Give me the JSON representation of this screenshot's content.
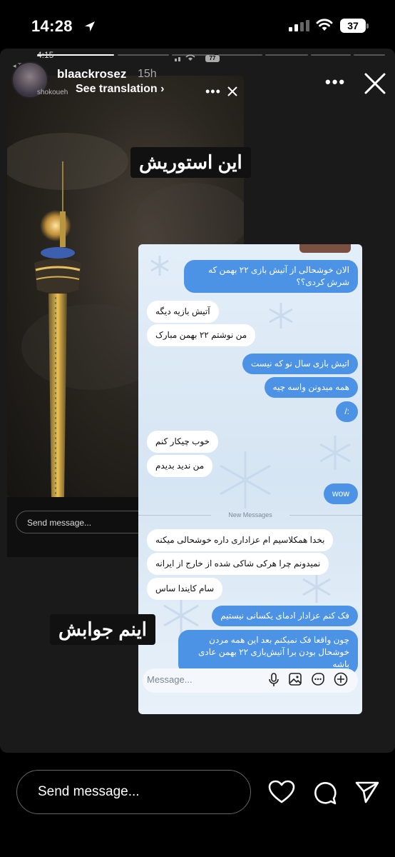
{
  "status_bar": {
    "time": "14:28",
    "battery": "37"
  },
  "inner_status": {
    "time": "4:15",
    "battery": "77",
    "back_label": "◂ Teams"
  },
  "story": {
    "username": "blaackrosez",
    "time_ago": "15h",
    "see_translation": "See translation",
    "avatar_label": "shokoueh",
    "label_top": "این استوریش",
    "label_bottom": "اینم جوابش",
    "inner_send_placeholder": "Send message..."
  },
  "chat": {
    "messages": [
      {
        "dir": "out",
        "text": "الان خوشحالی از آتیش بازی ۲۲ بهمن که شرش کردی؟؟"
      },
      {
        "dir": "in",
        "text": "آتیش بازیه دیگه"
      },
      {
        "dir": "in",
        "text": "من نوشتم ۲۲ بهمن مبارک"
      },
      {
        "dir": "out",
        "text": "اتیش بازی سال نو که نیست"
      },
      {
        "dir": "out",
        "text": "همه میدونن واسه چیه"
      },
      {
        "dir": "out",
        "text": ":/"
      },
      {
        "dir": "in",
        "text": "خوب چیکار کنم"
      },
      {
        "dir": "in",
        "text": "من ندید بدیدم"
      },
      {
        "dir": "out",
        "text": "wow"
      },
      {
        "dir": "in",
        "text": "بخدا همکلاسیم ام عزاداری داره خوشحالی میکنه"
      },
      {
        "dir": "in",
        "text": "نمیدونم چرا هرکی شاکی شده از خارج از ایرانه"
      },
      {
        "dir": "in",
        "text": "سام کایندا ساس"
      },
      {
        "dir": "out",
        "text": "فک کنم عزادار ادمای یکسانی نیستیم"
      },
      {
        "dir": "out",
        "text": "چون واقعا فک نمیکنم بعد این همه مردن خوشحال بودن برا آتیش‌بازی ۲۲ بهمن عادی باشه"
      }
    ],
    "new_messages_label": "New Messages",
    "input_placeholder": "Message..."
  },
  "footer": {
    "send_placeholder": "Send message..."
  },
  "icons": [
    "location-arrow-icon",
    "signal-icon",
    "wifi-icon",
    "battery-icon",
    "more-icon",
    "close-icon",
    "heart-icon",
    "comment-icon",
    "send-icon",
    "mic-icon",
    "gallery-icon",
    "sticker-icon",
    "plus-icon"
  ]
}
